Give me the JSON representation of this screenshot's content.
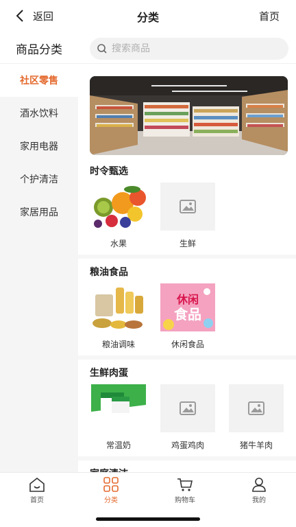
{
  "header": {
    "back_label": "返回",
    "title": "分类",
    "home_label": "首页"
  },
  "sidebar": {
    "title": "商品分类",
    "items": [
      {
        "label": "社区零售",
        "active": true
      },
      {
        "label": "酒水饮料"
      },
      {
        "label": "家用电器"
      },
      {
        "label": "个护清洁"
      },
      {
        "label": "家居用品"
      }
    ]
  },
  "search": {
    "placeholder": "搜索商品"
  },
  "sections": [
    {
      "title": "时令甄选",
      "items": [
        {
          "label": "水果",
          "image": "fruit-photo"
        },
        {
          "label": "生鲜",
          "image": "placeholder"
        }
      ]
    },
    {
      "title": "粮油食品",
      "items": [
        {
          "label": "粮油调味",
          "image": "grain-oil-photo"
        },
        {
          "label": "休闲食品",
          "image": "snack-photo"
        }
      ]
    },
    {
      "title": "生鲜肉蛋",
      "items": [
        {
          "label": "常温奶",
          "image": "milk-photo"
        },
        {
          "label": "鸡蛋鸡肉",
          "image": "placeholder"
        },
        {
          "label": "猪牛羊肉",
          "image": "placeholder"
        }
      ]
    },
    {
      "title": "家庭清洁",
      "items": []
    }
  ],
  "snack_art_text": {
    "line1": "休闲",
    "line2": "食品"
  },
  "tabbar": [
    {
      "label": "首页",
      "icon": "home-icon"
    },
    {
      "label": "分类",
      "icon": "category-icon",
      "active": true
    },
    {
      "label": "购物车",
      "icon": "cart-icon"
    },
    {
      "label": "我的",
      "icon": "user-icon"
    }
  ],
  "colors": {
    "accent": "#e46a2e",
    "sidebar_bg": "#f5f5f5",
    "placeholder_bg": "#f2f2f2"
  }
}
